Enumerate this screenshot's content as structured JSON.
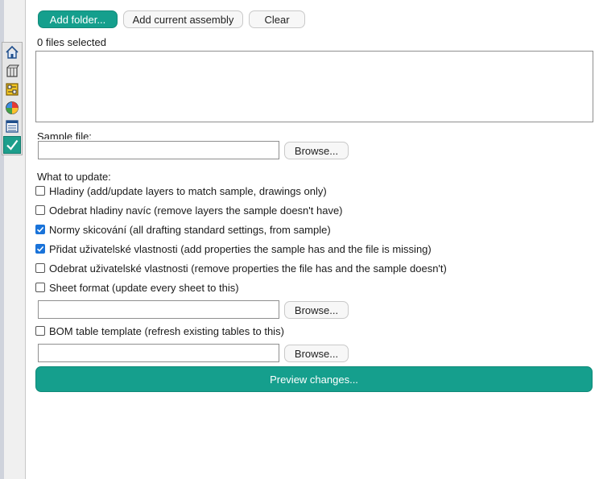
{
  "toolbar": {
    "add_folder": "Add folder...",
    "add_assembly": "Add current assembly",
    "clear": "Clear"
  },
  "files": {
    "selected_text": "0 files selected"
  },
  "sample": {
    "label": "Sample file:",
    "value": "",
    "browse": "Browse..."
  },
  "update": {
    "heading": "What to update:",
    "options": [
      {
        "label": "Hladiny (add/update layers to match sample, drawings only)",
        "checked": false
      },
      {
        "label": "Odebrat hladiny navíc (remove layers the sample doesn't have)",
        "checked": false
      },
      {
        "label": "Normy skicování (all drafting standard settings, from sample)",
        "checked": true
      },
      {
        "label": "Přidat uživatelské vlastnosti (add properties the sample has and the file is missing)",
        "checked": true
      },
      {
        "label": "Odebrat uživatelské vlastnosti (remove properties the file has and the sample doesn't)",
        "checked": false
      },
      {
        "label": "Sheet format (update every sheet to this)",
        "checked": false
      },
      {
        "label": "BOM table template (refresh existing tables to this)",
        "checked": false
      }
    ]
  },
  "sheet_format": {
    "value": "",
    "browse": "Browse..."
  },
  "bom_template": {
    "value": "",
    "browse": "Browse..."
  },
  "preview": {
    "label": "Preview changes..."
  },
  "side_tabs": [
    {
      "icon": "home-icon",
      "active": false
    },
    {
      "icon": "parts-icon",
      "active": false
    },
    {
      "icon": "configuration-icon",
      "active": false
    },
    {
      "icon": "appearance-icon",
      "active": false
    },
    {
      "icon": "list-icon",
      "active": false
    },
    {
      "icon": "checkmark-icon",
      "active": true
    }
  ],
  "colors": {
    "accent": "#159f8d",
    "checkbox": "#1a73d9"
  }
}
